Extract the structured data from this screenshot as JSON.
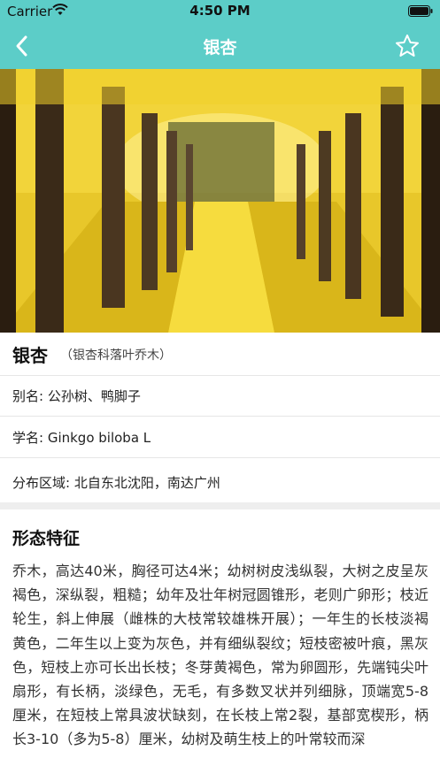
{
  "status_bar": {
    "carrier": "Carrier",
    "time": "4:50 PM"
  },
  "nav": {
    "title": "银杏",
    "back_icon": "chevron-left-icon",
    "star_icon": "star-outline-icon"
  },
  "colors": {
    "header": "#5ccdc8",
    "leaf": "#f0d22a"
  },
  "plant": {
    "name": "银杏",
    "family": "（银杏科落叶乔木）",
    "alias": "别名: 公孙树、鸭脚子",
    "latin": "学名: Ginkgo biloba L",
    "distribution": "分布区域: 北自东北沈阳，南达广州"
  },
  "morphology": {
    "title": "形态特征",
    "text": "乔木，高达40米，胸径可达4米；幼树树皮浅纵裂，大树之皮呈灰褐色，深纵裂，粗糙；幼年及壮年树冠圆锥形，老则广卵形；枝近轮生，斜上伸展（雌株的大枝常较雄株开展）；一年生的长枝淡褐黄色，二年生以上变为灰色，并有细纵裂纹；短枝密被叶痕，黑灰色，短枝上亦可长出长枝；冬芽黄褐色，常为卵圆形，先端钝尖叶扇形，有长柄，淡绿色，无毛，有多数叉状并列细脉，顶端宽5-8厘米，在短枝上常具波状缺刻，在长枝上常2裂，基部宽楔形，柄长3-10（多为5-8）厘米，幼树及萌生枝上的叶常较而深"
  }
}
